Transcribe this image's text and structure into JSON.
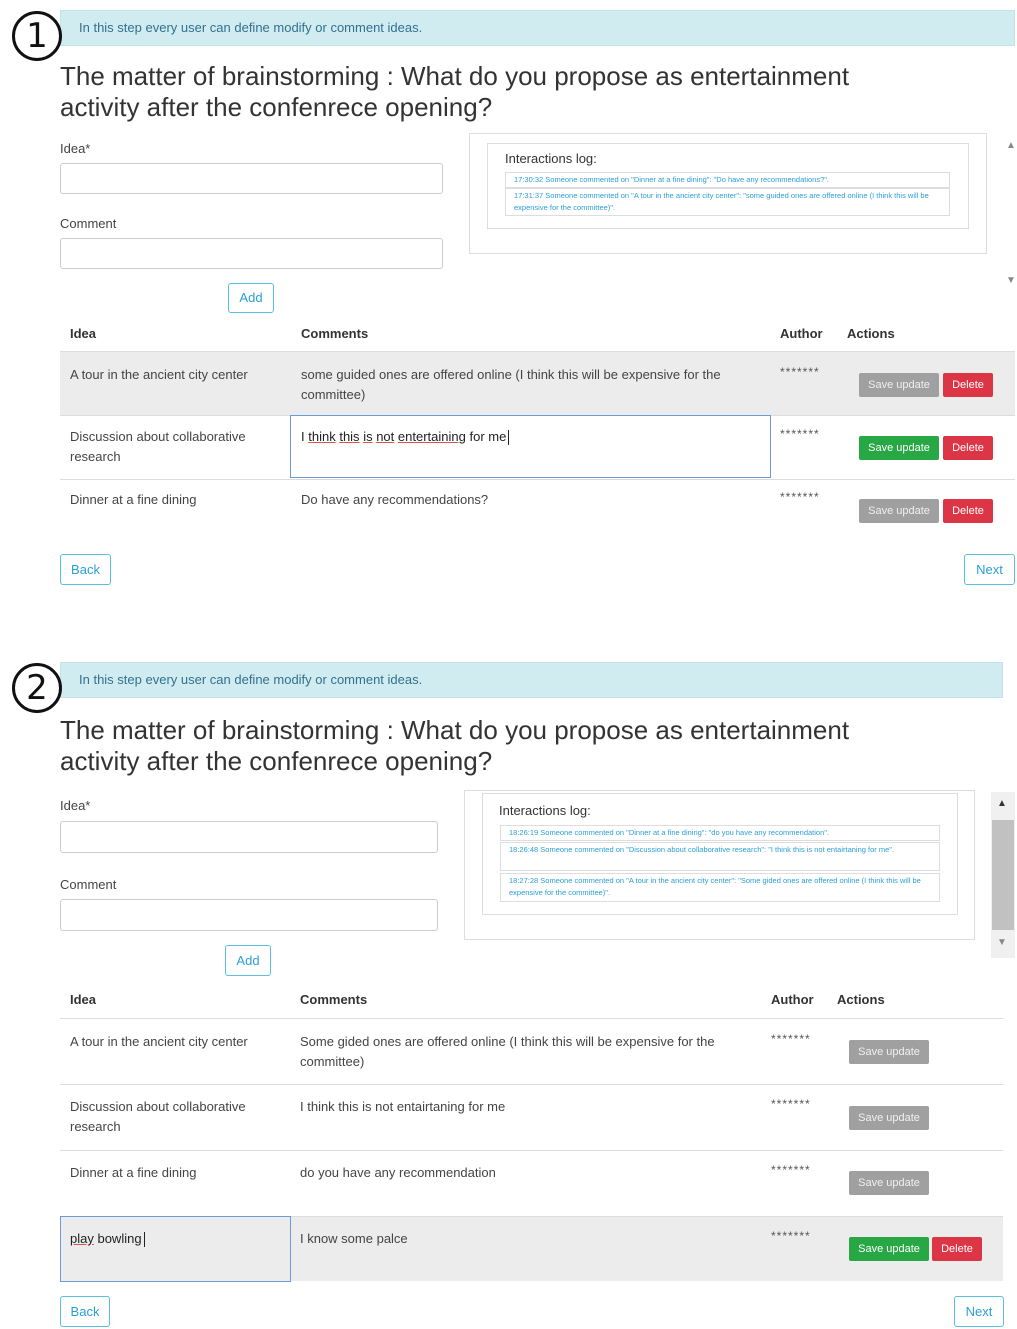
{
  "panel1": {
    "step_number": "1",
    "banner": "In this step every user can define modify or comment ideas.",
    "title_line1": "The matter of brainstorming : What do you propose as entertainment",
    "title_line2": "activity after the confenrece opening?",
    "idea_label": "Idea*",
    "comment_label": "Comment",
    "add_button": "Add",
    "log_title": "Interactions log:",
    "log_entries": [
      "17:30:32 Someone commented on \"Dinner at a fine dining\": \"Do have any recommendations?\".",
      "17:31:37 Someone commented on \"A tour in the ancient city center\": \"some guided ones are offered online (I think this will be expensive for the committee)\"."
    ],
    "headers": {
      "idea": "Idea",
      "comments": "Comments",
      "author": "Author",
      "actions": "Actions"
    },
    "rows": [
      {
        "idea": "A tour in the ancient city center",
        "comment": "some guided ones are offered online (I think this will be expensive for the committee)",
        "author": "*******",
        "save": "Save update",
        "delete": "Delete"
      },
      {
        "idea": "Discussion about collaborative research",
        "comment_parts": [
          "I ",
          "think",
          " ",
          "this",
          " ",
          "is",
          " ",
          "not",
          " ",
          "entertaining",
          " for me"
        ],
        "author": "*******",
        "save": "Save update",
        "delete": "Delete"
      },
      {
        "idea": "Dinner at a fine dining",
        "comment": "Do have any recommendations?",
        "author": "*******",
        "save": "Save update",
        "delete": "Delete"
      }
    ],
    "back": "Back",
    "next": "Next"
  },
  "panel2": {
    "step_number": "2",
    "banner": "In this step every user can define modify or comment ideas.",
    "title_line1": "The matter of brainstorming : What do you propose as entertainment",
    "title_line2": "activity after the confenrece opening?",
    "idea_label": "Idea*",
    "comment_label": "Comment",
    "add_button": "Add",
    "log_title": "Interactions log:",
    "log_entries": [
      "18:26:19 Someone commented on \"Dinner at a fine dining\": \"do you have any recommendation\".",
      "18:26:48 Someone commented on \"Discussion about collaborative research\": \"I think this is not entairtaning for me\".",
      "18:27:28 Someone commented on \"A tour in the ancient city center\": \"Some gided ones are offered online (I think this will be expensive for the committee)\"."
    ],
    "headers": {
      "idea": "Idea",
      "comments": "Comments",
      "author": "Author",
      "actions": "Actions"
    },
    "rows": [
      {
        "idea": "A tour in the ancient city center",
        "comment": "Some gided ones are offered online (I think this will be expensive for the committee)",
        "author": "*******",
        "save": "Save update"
      },
      {
        "idea": "Discussion about collaborative research",
        "comment": "I think this is not entairtaning for me",
        "author": "*******",
        "save": "Save update"
      },
      {
        "idea": "Dinner at a fine dining",
        "comment": "do you have any recommendation",
        "author": "*******",
        "save": "Save update"
      },
      {
        "idea_word1": "play",
        "idea_word2": " bowling",
        "comment": "I know some palce",
        "author": "*******",
        "save": "Save update",
        "delete": "Delete"
      }
    ],
    "back": "Back",
    "next": "Next"
  },
  "colors": {
    "banner_bg": "#d1ecf1",
    "save_active": "#28a745",
    "save_disabled": "#a0a0a0",
    "delete": "#dc3545",
    "outline_btn": "#5bc0de"
  }
}
